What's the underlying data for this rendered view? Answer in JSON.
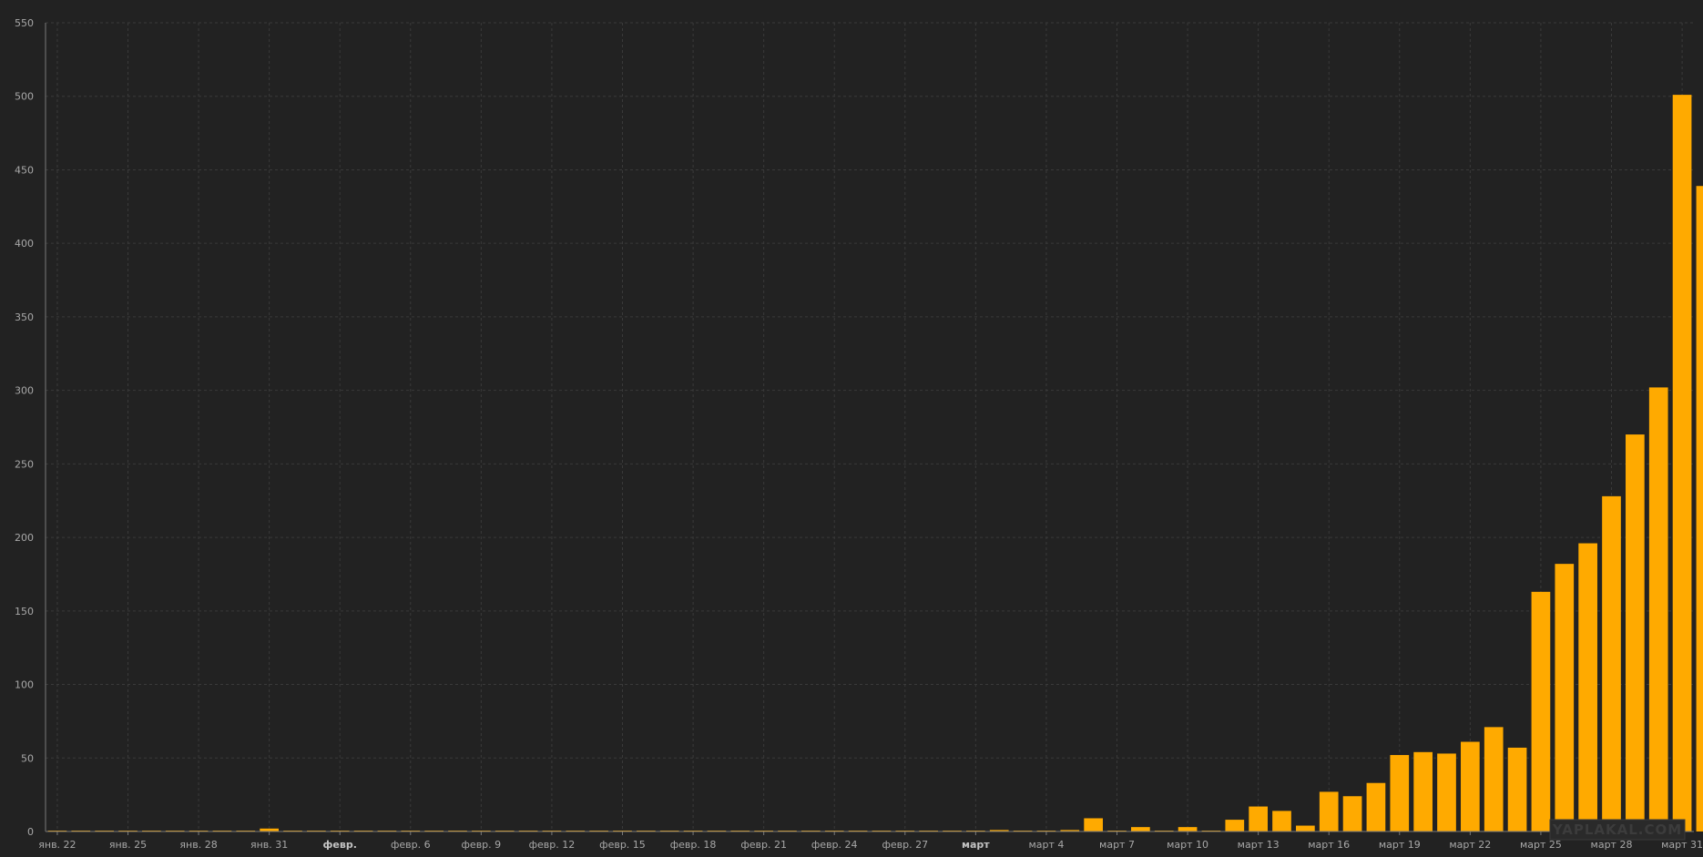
{
  "chart_data": {
    "type": "bar",
    "categories": [
      "янв. 22",
      "янв. 23",
      "янв. 24",
      "янв. 25",
      "янв. 26",
      "янв. 27",
      "янв. 28",
      "янв. 29",
      "янв. 30",
      "янв. 31",
      "февр. 1",
      "февр. 2",
      "февр. 3",
      "февр. 4",
      "февр. 5",
      "февр. 6",
      "февр. 7",
      "февр. 8",
      "февр. 9",
      "февр. 10",
      "февр. 11",
      "февр. 12",
      "февр. 13",
      "февр. 14",
      "февр. 15",
      "февр. 16",
      "февр. 17",
      "февр. 18",
      "февр. 19",
      "февр. 20",
      "февр. 21",
      "февр. 22",
      "февр. 23",
      "февр. 24",
      "февр. 25",
      "февр. 26",
      "февр. 27",
      "февр. 28",
      "февр. 29",
      "март 1",
      "март 2",
      "март 3",
      "март 4",
      "март 5",
      "март 6",
      "март 7",
      "март 8",
      "март 9",
      "март 10",
      "март 11",
      "март 12",
      "март 13",
      "март 14",
      "март 15",
      "март 16",
      "март 17",
      "март 18",
      "март 19",
      "март 20",
      "март 21",
      "март 22",
      "март 23",
      "март 24",
      "март 25",
      "март 26",
      "март 27",
      "март 28",
      "март 29",
      "март 30",
      "март 31"
    ],
    "values": [
      0,
      0,
      0,
      0,
      0,
      0,
      0,
      0,
      0,
      2,
      0,
      0,
      0,
      0,
      0,
      0,
      0,
      0,
      0,
      0,
      0,
      0,
      0,
      0,
      0,
      0,
      0,
      0,
      0,
      0,
      0,
      0,
      0,
      0,
      0,
      0,
      0,
      0,
      0,
      0,
      1,
      0,
      0,
      1,
      9,
      0,
      3,
      0,
      3,
      0,
      8,
      17,
      14,
      4,
      27,
      24,
      33,
      52,
      54,
      53,
      61,
      71,
      57,
      163,
      182,
      196,
      228,
      270,
      302,
      501,
      439
    ],
    "ylim": [
      0,
      550
    ],
    "y_ticks": [
      "0",
      "50",
      "100",
      "150",
      "200",
      "250",
      "300",
      "350",
      "400",
      "450",
      "500",
      "550"
    ],
    "x_ticks": [
      {
        "index": 0,
        "label": "янв. 22"
      },
      {
        "index": 3,
        "label": "янв. 25"
      },
      {
        "index": 6,
        "label": "янв. 28"
      },
      {
        "index": 9,
        "label": "янв. 31"
      },
      {
        "index": 12,
        "label": "февр.",
        "bold": true
      },
      {
        "index": 15,
        "label": "февр. 6"
      },
      {
        "index": 18,
        "label": "февр. 9"
      },
      {
        "index": 21,
        "label": "февр. 12"
      },
      {
        "index": 24,
        "label": "февр. 15"
      },
      {
        "index": 27,
        "label": "февр. 18"
      },
      {
        "index": 30,
        "label": "февр. 21"
      },
      {
        "index": 33,
        "label": "февр. 24"
      },
      {
        "index": 36,
        "label": "февр. 27"
      },
      {
        "index": 39,
        "label": "март",
        "bold": true
      },
      {
        "index": 42,
        "label": "март 4"
      },
      {
        "index": 45,
        "label": "март 7"
      },
      {
        "index": 48,
        "label": "март 10"
      },
      {
        "index": 51,
        "label": "март 13"
      },
      {
        "index": 54,
        "label": "март 16"
      },
      {
        "index": 57,
        "label": "март 19"
      },
      {
        "index": 60,
        "label": "март 22"
      },
      {
        "index": 63,
        "label": "март 25"
      },
      {
        "index": 66,
        "label": "март 28"
      },
      {
        "index": 69,
        "label": "март 31"
      }
    ],
    "grid": true,
    "colors": {
      "background": "#222222",
      "bar": "#ffaa00",
      "grid": "#3a3a3a",
      "tick_text": "#a8a8a8",
      "axis": "#7a7a7a"
    }
  },
  "watermark": {
    "text": "YAPLAKAL.COM"
  }
}
